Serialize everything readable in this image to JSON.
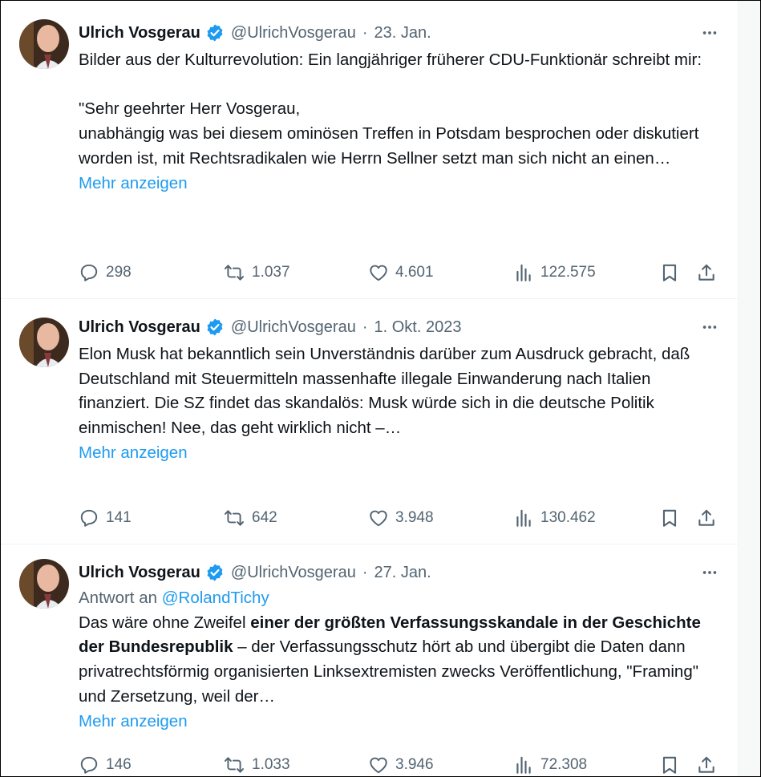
{
  "tweets": [
    {
      "author": "Ulrich Vosgerau",
      "handle": "@UlrichVosgerau",
      "separator": "·",
      "date": "23. Jan.",
      "text": "Bilder aus der Kulturrevolution: Ein langjähriger früherer CDU-Funktionär schreibt mir:\n\n\"Sehr geehrter Herr Vosgerau,\nunabhängig was bei diesem ominösen Treffen in Potsdam besprochen oder diskutiert worden ist, mit Rechtsradikalen wie Herrn Sellner setzt man sich nicht an einen…",
      "show_more": "Mehr anzeigen",
      "replies": "298",
      "retweets": "1.037",
      "likes": "4.601",
      "views": "122.575"
    },
    {
      "author": "Ulrich Vosgerau",
      "handle": "@UlrichVosgerau",
      "separator": "·",
      "date": "1. Okt. 2023",
      "text": "Elon Musk hat bekanntlich sein Unverständnis darüber zum Ausdruck gebracht, daß Deutschland mit Steuermitteln massenhafte illegale Einwanderung nach Italien finanziert. Die SZ findet das skandalös: Musk würde sich in die deutsche Politik einmischen! Nee, das geht wirklich nicht –…",
      "show_more": "Mehr anzeigen",
      "replies": "141",
      "retweets": "642",
      "likes": "3.948",
      "views": "130.462"
    },
    {
      "author": "Ulrich Vosgerau",
      "handle": "@UlrichVosgerau",
      "separator": "·",
      "date": "27. Jan.",
      "reply_prefix": "Antwort an",
      "reply_to": "@RolandTichy",
      "text_before": "Das wäre ohne Zweifel ",
      "text_bold": "einer der größten Verfassungsskandale in der Geschichte der Bundesrepublik",
      "text_after": " – der Verfassungsschutz hört ab und übergibt die Daten dann privatrechtsförmig organisierten Linksextremisten zwecks Veröffentlichung, \"Framing\" und Zersetzung, weil der…",
      "show_more": "Mehr anzeigen",
      "replies": "146",
      "retweets": "1.033",
      "likes": "3.946",
      "views": "72.308"
    }
  ],
  "icons": {
    "verified": "verified-badge-icon",
    "more": "more-horizontal-icon",
    "reply": "reply-bubble-icon",
    "retweet": "retweet-icon",
    "like": "heart-icon",
    "views": "views-bar-chart-icon",
    "bookmark": "bookmark-icon",
    "share": "share-upload-icon"
  },
  "colors": {
    "text": "#0f1419",
    "secondary": "#536471",
    "link": "#1d9bf0",
    "verified": "#1d9bf0",
    "divider": "#eff3f4"
  }
}
